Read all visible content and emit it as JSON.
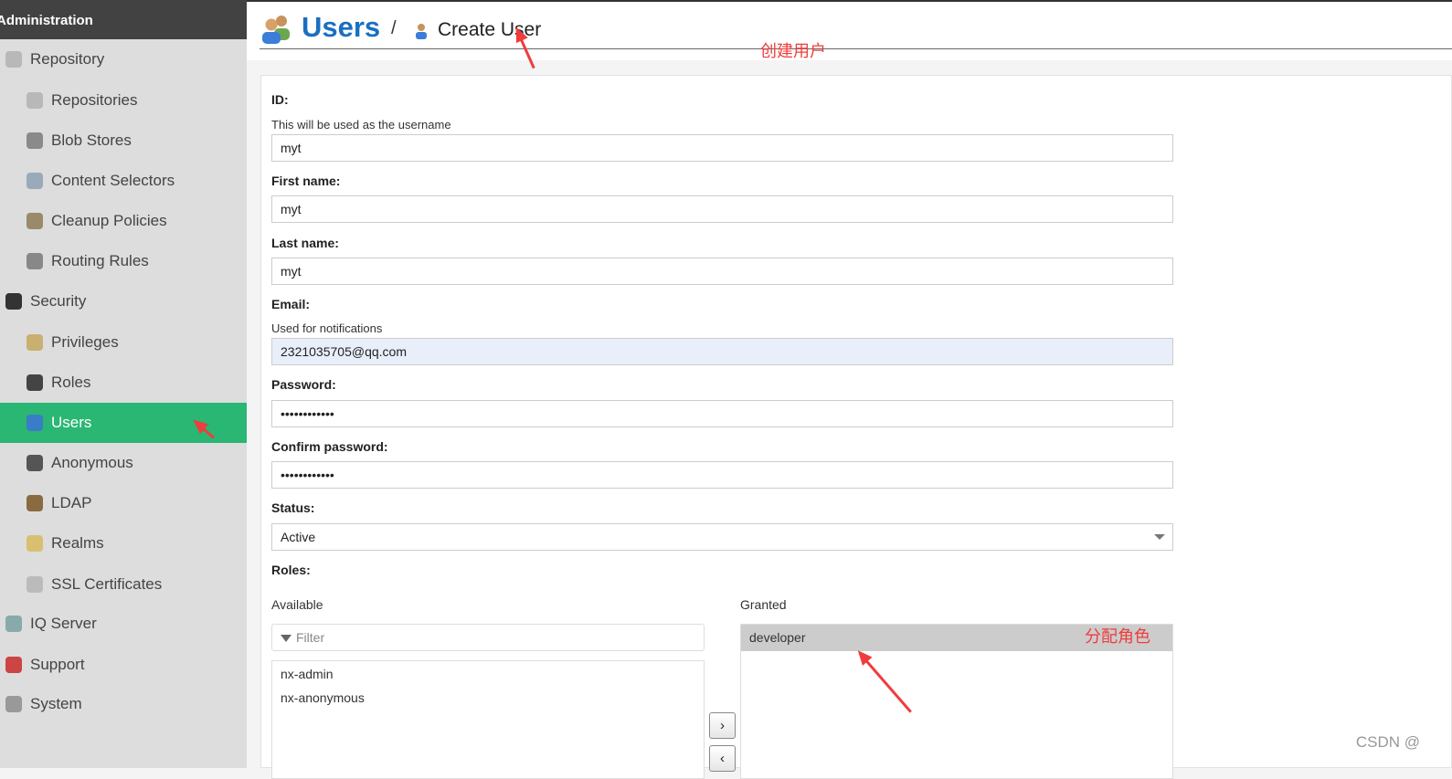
{
  "sidebar": {
    "header": "Administration",
    "items": [
      {
        "label": "Repository",
        "icon": "database-icon",
        "level": 1,
        "color": "#b8b8b8"
      },
      {
        "label": "Repositories",
        "icon": "database-icon",
        "level": 2,
        "color": "#b8b8b8"
      },
      {
        "label": "Blob Stores",
        "icon": "server-icon",
        "level": 2,
        "color": "#8a8a8a"
      },
      {
        "label": "Content Selectors",
        "icon": "circles-icon",
        "level": 2,
        "color": "#9ab"
      },
      {
        "label": "Cleanup Policies",
        "icon": "broom-icon",
        "level": 2,
        "color": "#9a8a6a"
      },
      {
        "label": "Routing Rules",
        "icon": "drive-icon",
        "level": 2,
        "color": "#888"
      },
      {
        "label": "Security",
        "icon": "badge-icon",
        "level": 1,
        "color": "#333"
      },
      {
        "label": "Privileges",
        "icon": "medal-icon",
        "level": 2,
        "color": "#c9b070"
      },
      {
        "label": "Roles",
        "icon": "officer-icon",
        "level": 2,
        "color": "#444"
      },
      {
        "label": "Users",
        "icon": "users-icon",
        "level": 2,
        "color": "#3a7cc8",
        "active": true
      },
      {
        "label": "Anonymous",
        "icon": "user-silhouette-icon",
        "level": 2,
        "color": "#555"
      },
      {
        "label": "LDAP",
        "icon": "book-icon",
        "level": 2,
        "color": "#8a6a40"
      },
      {
        "label": "Realms",
        "icon": "shield-icon",
        "level": 2,
        "color": "#d8c070"
      },
      {
        "label": "SSL Certificates",
        "icon": "certificate-icon",
        "level": 2,
        "color": "#bbb"
      },
      {
        "label": "IQ Server",
        "icon": "iq-icon",
        "level": 1,
        "color": "#8aa"
      },
      {
        "label": "Support",
        "icon": "lifebuoy-icon",
        "level": 1,
        "color": "#c44"
      },
      {
        "label": "System",
        "icon": "gear-icon",
        "level": 1,
        "color": "#999"
      }
    ]
  },
  "header": {
    "title": "Users",
    "separator": "/",
    "subtitle": "Create User"
  },
  "annotations": {
    "create": "创建用户",
    "assign": "分配角色",
    "accent": "#f03c3c"
  },
  "form": {
    "id": {
      "label": "ID:",
      "help": "This will be used as the username",
      "value": "myt"
    },
    "first_name": {
      "label": "First name:",
      "value": "myt"
    },
    "last_name": {
      "label": "Last name:",
      "value": "myt"
    },
    "email": {
      "label": "Email:",
      "help": "Used for notifications",
      "value": "2321035705@qq.com"
    },
    "password": {
      "label": "Password:",
      "value": "••••••••••••"
    },
    "confirm_password": {
      "label": "Confirm password:",
      "value": "••••••••••••"
    },
    "status": {
      "label": "Status:",
      "value": "Active"
    },
    "roles": {
      "label": "Roles:",
      "available_label": "Available",
      "granted_label": "Granted",
      "filter_placeholder": "Filter",
      "available": [
        "nx-admin",
        "nx-anonymous"
      ],
      "granted": [
        "developer"
      ],
      "add_button": "›",
      "remove_button": "‹"
    }
  },
  "watermark": "CSDN @"
}
